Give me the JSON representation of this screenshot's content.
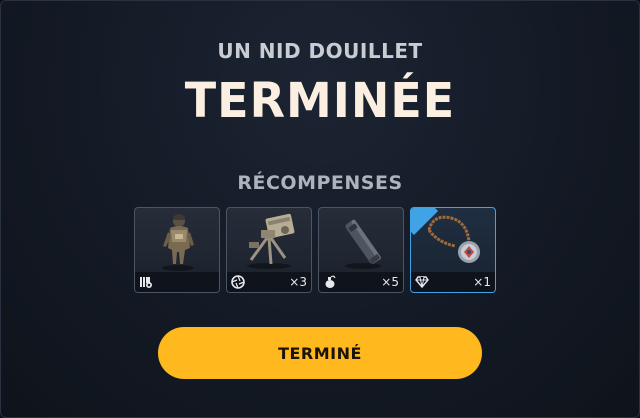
{
  "mission": {
    "subtitle": "UN NID DOUILLET",
    "title": "TERMINÉE"
  },
  "rewards": {
    "label": "RÉCOMPENSES",
    "items": [
      {
        "type_icon": "outfit-icon",
        "item_icon": "soldier-outfit-icon",
        "quantity": "",
        "rarity": "common"
      },
      {
        "type_icon": "camera-aperture-icon",
        "item_icon": "turret-gadget-icon",
        "quantity": "×3",
        "rarity": "common"
      },
      {
        "type_icon": "bomb-icon",
        "item_icon": "canister-icon",
        "quantity": "×5",
        "rarity": "common"
      },
      {
        "type_icon": "diamond-icon",
        "item_icon": "amulet-pendant-icon",
        "quantity": "×1",
        "rarity": "legendary"
      }
    ]
  },
  "actions": {
    "done_label": "TERMINÉ"
  },
  "colors": {
    "accent": "#ffb81e",
    "legendary": "#3fa3e6",
    "background": "#141a25"
  }
}
